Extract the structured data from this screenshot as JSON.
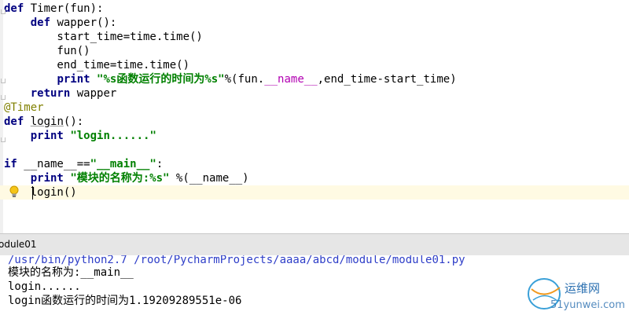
{
  "editor": {
    "lines": [
      [
        {
          "t": "def",
          "c": "kw"
        },
        {
          "t": " Timer(fun):",
          "c": "plain"
        }
      ],
      [
        {
          "t": "    ",
          "c": "plain"
        },
        {
          "t": "def",
          "c": "kw"
        },
        {
          "t": " wapper():",
          "c": "plain"
        }
      ],
      [
        {
          "t": "        start_time=time.time()",
          "c": "plain"
        }
      ],
      [
        {
          "t": "        fun()",
          "c": "plain"
        }
      ],
      [
        {
          "t": "        end_time=time.time()",
          "c": "plain"
        }
      ],
      [
        {
          "t": "        ",
          "c": "plain"
        },
        {
          "t": "print",
          "c": "kw"
        },
        {
          "t": " ",
          "c": "plain"
        },
        {
          "t": "\"%s函数运行的时间为%s\"",
          "c": "str"
        },
        {
          "t": "%(fun.",
          "c": "plain"
        },
        {
          "t": "__name__",
          "c": "dunder"
        },
        {
          "t": ",end_time-start_time)",
          "c": "plain"
        }
      ],
      [
        {
          "t": "    ",
          "c": "plain"
        },
        {
          "t": "return",
          "c": "kw"
        },
        {
          "t": " wapper",
          "c": "plain"
        }
      ],
      [
        {
          "t": "@Timer",
          "c": "deco"
        }
      ],
      [
        {
          "t": "def",
          "c": "kw"
        },
        {
          "t": " ",
          "c": "plain"
        },
        {
          "t": "login",
          "c": "plain u"
        },
        {
          "t": "():",
          "c": "plain"
        }
      ],
      [
        {
          "t": "    ",
          "c": "plain"
        },
        {
          "t": "print",
          "c": "kw"
        },
        {
          "t": " ",
          "c": "plain"
        },
        {
          "t": "\"login......\"",
          "c": "str"
        }
      ],
      [],
      [
        {
          "t": "if",
          "c": "kw"
        },
        {
          "t": " __name__==",
          "c": "plain"
        },
        {
          "t": "\"__main__\"",
          "c": "str"
        },
        {
          "t": ":",
          "c": "plain"
        }
      ],
      [
        {
          "t": "    ",
          "c": "plain"
        },
        {
          "t": "print",
          "c": "kw"
        },
        {
          "t": " ",
          "c": "plain"
        },
        {
          "t": "\"模块的名称为:%s\"",
          "c": "str"
        },
        {
          "t": " %(__name__)",
          "c": "plain"
        }
      ],
      [
        {
          "t": "    login()",
          "c": "plain"
        }
      ]
    ],
    "current_line": 13,
    "intention_icon": "lightbulb-icon"
  },
  "run_panel": {
    "tab_label": "odule01"
  },
  "console": {
    "lines": [
      {
        "text": "/usr/bin/python2.7 /root/PycharmProjects/aaaa/abcd/module/module01.py",
        "kind": "cmd"
      },
      {
        "text": "模块的名称为:__main__",
        "kind": "out"
      },
      {
        "text": "login......",
        "kind": "out"
      },
      {
        "text": "login函数运行的时间为1.19209289551e-06",
        "kind": "out"
      }
    ]
  },
  "watermark": {
    "text": "运维网",
    "sub": "51yunwei.com",
    "icon": "globe-logo-icon"
  }
}
